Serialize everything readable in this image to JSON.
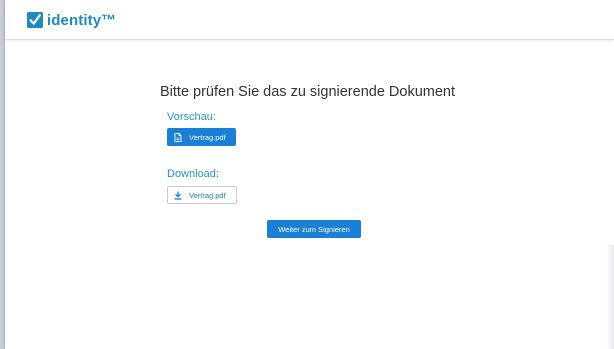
{
  "header": {
    "brand_name": "identity™"
  },
  "main": {
    "title": "Bitte prüfen Sie das zu signierende Dokument",
    "preview": {
      "label": "Vorschau:",
      "file_button_label": "Vertrag.pdf",
      "icon": "file-icon"
    },
    "download": {
      "label": "Download:",
      "file_button_label": "Vertrag.pdf",
      "icon": "download-icon"
    },
    "continue_button_label": "Weiter zum Signieren"
  },
  "colors": {
    "brand": "#1f8ac2",
    "primary_button": "#1a7fd6",
    "section_label": "#2a93c9",
    "backdrop_band": "#0d6277"
  }
}
